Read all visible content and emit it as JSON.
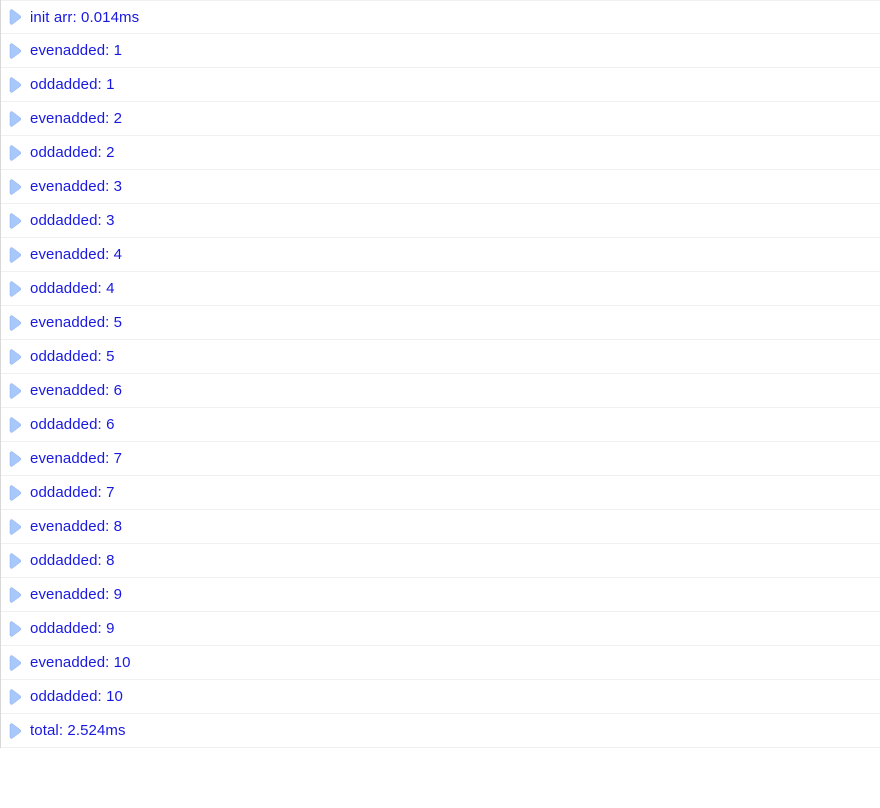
{
  "console": {
    "entries": [
      {
        "text": "init arr: 0.014ms"
      },
      {
        "text": "evenadded: 1"
      },
      {
        "text": "oddadded: 1"
      },
      {
        "text": "evenadded: 2"
      },
      {
        "text": "oddadded: 2"
      },
      {
        "text": "evenadded: 3"
      },
      {
        "text": "oddadded: 3"
      },
      {
        "text": "evenadded: 4"
      },
      {
        "text": "oddadded: 4"
      },
      {
        "text": "evenadded: 5"
      },
      {
        "text": "oddadded: 5"
      },
      {
        "text": "evenadded: 6"
      },
      {
        "text": "oddadded: 6"
      },
      {
        "text": "evenadded: 7"
      },
      {
        "text": "oddadded: 7"
      },
      {
        "text": "evenadded: 8"
      },
      {
        "text": "oddadded: 8"
      },
      {
        "text": "evenadded: 9"
      },
      {
        "text": "oddadded: 9"
      },
      {
        "text": "evenadded: 10"
      },
      {
        "text": "oddadded: 10"
      },
      {
        "text": "total: 2.524ms"
      }
    ]
  }
}
